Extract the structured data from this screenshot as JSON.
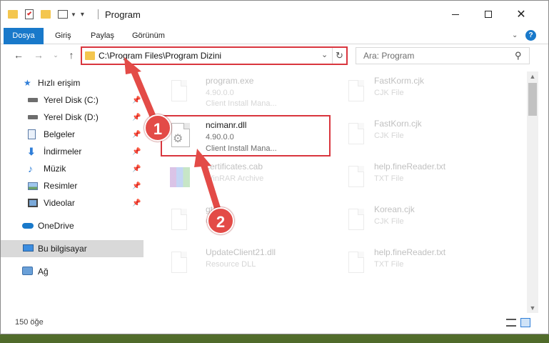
{
  "window": {
    "title": "Program",
    "controls": [
      "minimize",
      "maximize",
      "close"
    ]
  },
  "ribbon": {
    "tabs": [
      {
        "label": "Dosya"
      },
      {
        "label": "Giriş"
      },
      {
        "label": "Paylaş"
      },
      {
        "label": "Görünüm"
      }
    ],
    "help": "?"
  },
  "navigation": {
    "address": "C:\\Program Files\\Program Dizini",
    "search_placeholder": "Ara: Program"
  },
  "sidebar": {
    "quick_access": "Hızlı erişim",
    "items": [
      {
        "label": "Yerel Disk (C:)",
        "icon": "drive-icon",
        "pinned": true
      },
      {
        "label": "Yerel Disk (D:)",
        "icon": "drive-icon",
        "pinned": true
      },
      {
        "label": "Belgeler",
        "icon": "documents-icon",
        "pinned": true
      },
      {
        "label": "İndirmeler",
        "icon": "downloads-icon",
        "pinned": true
      },
      {
        "label": "Müzik",
        "icon": "music-icon",
        "pinned": true
      },
      {
        "label": "Resimler",
        "icon": "pictures-icon",
        "pinned": true
      },
      {
        "label": "Videolar",
        "icon": "videos-icon",
        "pinned": true
      }
    ],
    "onedrive": "OneDrive",
    "this_pc": "Bu bilgisayar",
    "network": "Ağ"
  },
  "files": {
    "col1": [
      {
        "name": "program.exe",
        "line2": "4.90.0.0",
        "line3": "Client Install Mana..."
      },
      {
        "name": "ncimanr.dll",
        "line2": "4.90.0.0",
        "line3": "Client Install Mana..."
      },
      {
        "name": "certificates.cab",
        "line2": "WinRAR Archive",
        "line3": ""
      },
      {
        "name": "gtdt",
        "line2": "C",
        "line3": ""
      },
      {
        "name": "UpdateClient21.dll",
        "line2": "Resource DLL",
        "line3": ""
      }
    ],
    "col2": [
      {
        "name": "FastKorm.cjk",
        "line2": "CJK File"
      },
      {
        "name": "FastKorn.cjk",
        "line2": "CJK File"
      },
      {
        "name": "help.fineReader.txt",
        "line2": "TXT File"
      },
      {
        "name": "Korean.cjk",
        "line2": "CJK File"
      },
      {
        "name": "help.fineReader.txt",
        "line2": "TXT File"
      }
    ]
  },
  "status": {
    "count": "150 öğe"
  },
  "annotations": {
    "badge1": "1",
    "badge2": "2",
    "color": "#d9363e"
  }
}
